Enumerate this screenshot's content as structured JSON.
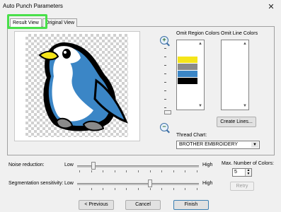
{
  "window": {
    "title": "Auto Punch Parameters",
    "close": "✕"
  },
  "tabs": [
    {
      "label": "Result View"
    },
    {
      "label": "Original View"
    }
  ],
  "colors_section": {
    "omit_region_label": "Omit Region Colors",
    "omit_line_label": "Omit Line Colors",
    "region_colors": [
      "#f5e51a",
      "#8a8a8a",
      "#3b86c6",
      "#000000"
    ]
  },
  "icons": {
    "zoom_in": "zoom-in-icon",
    "zoom_out": "zoom-out-icon"
  },
  "create_lines_button": "Create Lines...",
  "thread_chart": {
    "label": "Thread Chart:",
    "value": "BROTHER EMBROIDERY"
  },
  "noise_reduction": {
    "label": "Noise reduction:",
    "low": "Low",
    "high": "High",
    "level": 0.12
  },
  "segmentation": {
    "label": "Segmentation sensitivity:",
    "low": "Low",
    "high": "High",
    "level": 0.6
  },
  "max_colors": {
    "label": "Max. Number of Colors:",
    "value": "5"
  },
  "retry_button": "Retry",
  "buttons": {
    "previous": "< Previous",
    "cancel": "Cancel",
    "finish": "Finish"
  }
}
